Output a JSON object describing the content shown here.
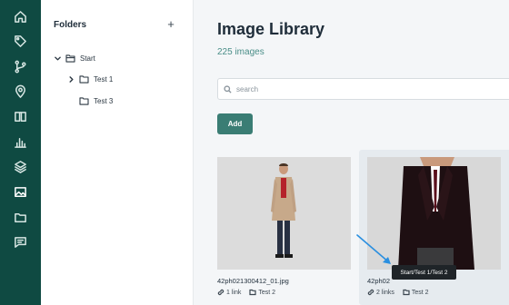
{
  "rail": {
    "items": [
      {
        "icon": "home-icon"
      },
      {
        "icon": "tag-icon"
      },
      {
        "icon": "branch-icon"
      },
      {
        "icon": "location-pin-icon"
      },
      {
        "icon": "book-icon"
      },
      {
        "icon": "bar-chart-icon"
      },
      {
        "icon": "layers-icon"
      },
      {
        "icon": "image-icon",
        "active": true
      },
      {
        "icon": "folder-icon"
      },
      {
        "icon": "chat-icon"
      }
    ],
    "bg_color": "#0f4a42"
  },
  "folders": {
    "title": "Folders",
    "add_label": "+",
    "tree": [
      {
        "label": "Start",
        "expanded": true
      },
      {
        "label": "Test 1",
        "expanded": false
      },
      {
        "label": "Test 3"
      }
    ]
  },
  "main": {
    "title": "Image Library",
    "count": "225 images",
    "search_placeholder": "search",
    "add_label": "Add",
    "accent_color": "#3a7d74"
  },
  "cards": [
    {
      "file": "42ph021300412_01.jpg",
      "links": "1 link",
      "folder": "Test 2"
    },
    {
      "file": "42ph02",
      "links": "2 links",
      "folder": "Test 2"
    }
  ],
  "tooltip": "Start/Test 1/Test 2"
}
